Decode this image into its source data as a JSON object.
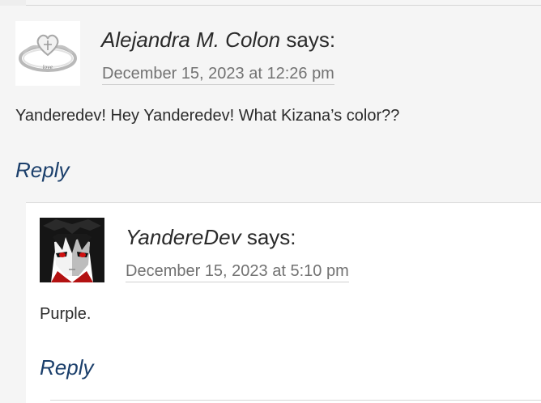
{
  "comments": [
    {
      "author": "Alejandra M. Colon",
      "says": "says:",
      "date": "December 15, 2023 at 12:26 pm",
      "text": "Yanderedev! Hey Yanderedev! What Kizana’s color??",
      "reply_label": "Reply",
      "avatar_icon": "ring-icon",
      "avatar_text": "love"
    },
    {
      "author": "YandereDev",
      "says": "says:",
      "date": "December 15, 2023 at 5:10 pm",
      "text": "Purple.",
      "reply_label": "Reply",
      "avatar_icon": "anime-character-icon"
    }
  ],
  "colors": {
    "link": "#1b3f6b",
    "date": "#727272",
    "text": "#2b2b2b",
    "parent_bg": "#f5f5f5",
    "child_bg": "#ffffff"
  }
}
